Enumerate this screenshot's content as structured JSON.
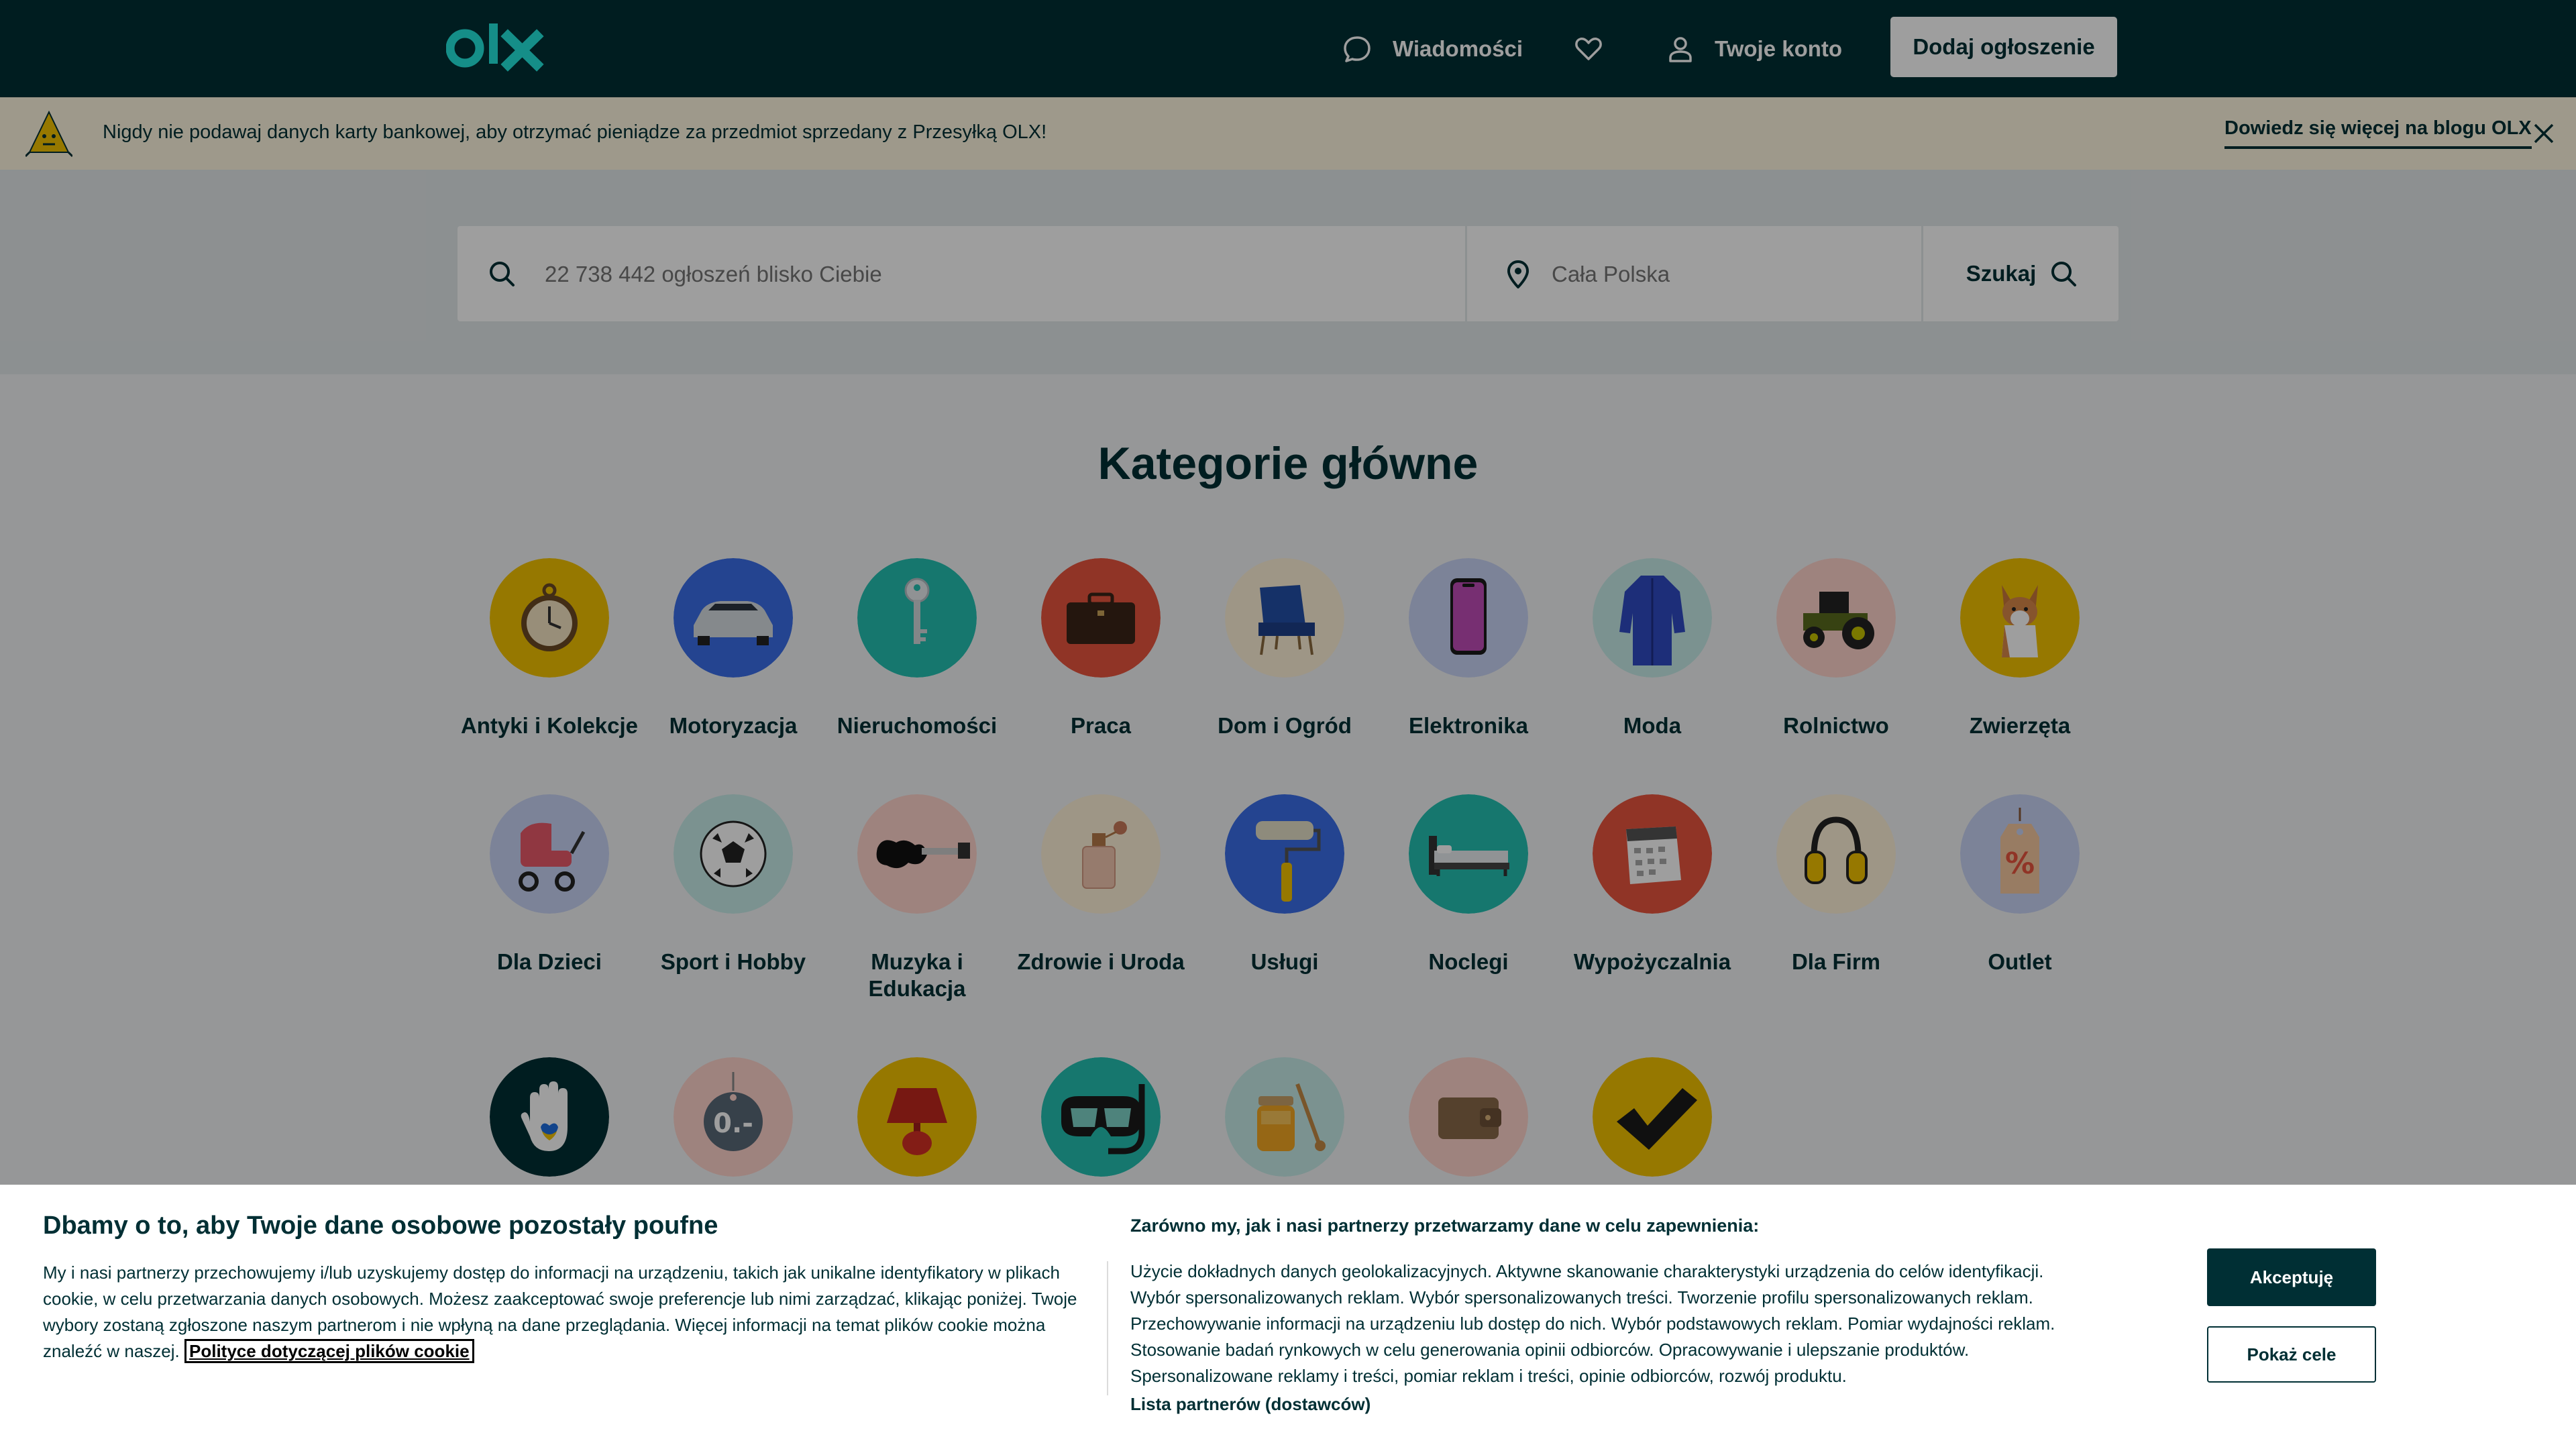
{
  "header": {
    "logo_text": "olx",
    "nav": {
      "messages": "Wiadomości",
      "account": "Twoje konto"
    },
    "post_button": "Dodaj ogłoszenie"
  },
  "banner": {
    "text": "Nigdy nie podawaj danych karty bankowej, aby otrzymać pieniądze za przedmiot sprzedany z Przesyłką OLX!",
    "link": "Dowiedz się więcej na blogu OLX"
  },
  "search": {
    "query_placeholder": "22 738 442 ogłoszeń blisko Ciebie",
    "location_placeholder": "Cała Polska",
    "button": "Szukaj"
  },
  "categories": {
    "title": "Kategorie główne",
    "items": [
      {
        "label": "Antyki i Kolekcje",
        "icon": "pocket-watch-icon",
        "color": "#f2c200"
      },
      {
        "label": "Motoryzacja",
        "icon": "car-icon",
        "color": "#3a6ee8"
      },
      {
        "label": "Nieruchomości",
        "icon": "key-icon",
        "color": "#24c1b2"
      },
      {
        "label": "Praca",
        "icon": "briefcase-icon",
        "color": "#e8553e"
      },
      {
        "label": "Dom i Ogród",
        "icon": "armchair-icon",
        "color": "#fff3d9"
      },
      {
        "label": "Elektronika",
        "icon": "smartphone-icon",
        "color": "#c9d4f5"
      },
      {
        "label": "Moda",
        "icon": "robe-icon",
        "color": "#c7ece8"
      },
      {
        "label": "Rolnictwo",
        "icon": "tractor-icon",
        "color": "#ffd3cc"
      },
      {
        "label": "Zwierzęta",
        "icon": "dog-icon",
        "color": "#f2c200"
      },
      {
        "label": "Dla Dzieci",
        "icon": "stroller-icon",
        "color": "#c9d4f5"
      },
      {
        "label": "Sport i Hobby",
        "icon": "football-icon",
        "color": "#c7ece8"
      },
      {
        "label": "Muzyka i Edukacja",
        "icon": "guitar-icon",
        "color": "#ffd3cc"
      },
      {
        "label": "Zdrowie i Uroda",
        "icon": "perfume-icon",
        "color": "#fff3d9"
      },
      {
        "label": "Usługi",
        "icon": "paint-roller-icon",
        "color": "#3a6ee8"
      },
      {
        "label": "Noclegi",
        "icon": "bed-icon",
        "color": "#24c1b2"
      },
      {
        "label": "Wypożyczalnia",
        "icon": "calendar-icon",
        "color": "#e8553e"
      },
      {
        "label": "Dla Firm",
        "icon": "ear-protectors-icon",
        "color": "#fff3d9"
      },
      {
        "label": "Outlet",
        "icon": "sale-tag-icon",
        "color": "#c9d4f5"
      },
      {
        "label": "",
        "icon": "ukraine-hand-icon",
        "color": "#002f34"
      },
      {
        "label": "",
        "icon": "free-tag-icon",
        "color": "#ffd3cc"
      },
      {
        "label": "",
        "icon": "lamp-icon",
        "color": "#f2c200"
      },
      {
        "label": "",
        "icon": "snorkel-mask-icon",
        "color": "#24c1b2"
      },
      {
        "label": "",
        "icon": "honey-jar-icon",
        "color": "#c7ece8"
      },
      {
        "label": "",
        "icon": "wallet-icon",
        "color": "#ffd3cc"
      },
      {
        "label": "",
        "icon": "check-badge-icon",
        "color": "#f2c200"
      }
    ]
  },
  "cookie": {
    "title": "Dbamy o to, aby Twoje dane osobowe pozostały poufne",
    "text": "My i nasi partnerzy przechowujemy i/lub uzyskujemy dostęp do informacji na urządzeniu, takich jak unikalne identyfikatory w plikach cookie, w celu przetwarzania danych osobowych. Możesz zaakceptować swoje preferencje lub nimi zarządzać, klikając poniżej. Twoje wybory zostaną zgłoszone naszym partnerom i nie wpłyną na dane przeglądania. Więcej informacji na temat plików cookie można znaleźć w naszej.",
    "policy_link": "Polityce dotyczącej plików cookie",
    "purposes_title": "Zarówno my, jak i nasi partnerzy przetwarzamy dane w celu zapewnienia:",
    "purposes_text": "Użycie dokładnych danych geolokalizacyjnych. Aktywne skanowanie charakterystyki urządzenia do celów identyfikacji. Wybór spersonalizowanych reklam. Wybór spersonalizowanych treści. Tworzenie profilu spersonalizowanych reklam. Przechowywanie informacji na urządzeniu lub dostęp do nich. Wybór podstawowych reklam. Pomiar wydajności reklam. Stosowanie badań rynkowych w celu generowania opinii odbiorców. Opracowywanie i ulepszanie produktów. Spersonalizowane reklamy i treści, pomiar reklam i treści, opinie odbiorców, rozwój produktu.",
    "partners_link": "Lista partnerów (dostawców)",
    "accept_button": "Akceptuję",
    "goals_button": "Pokaż cele"
  }
}
